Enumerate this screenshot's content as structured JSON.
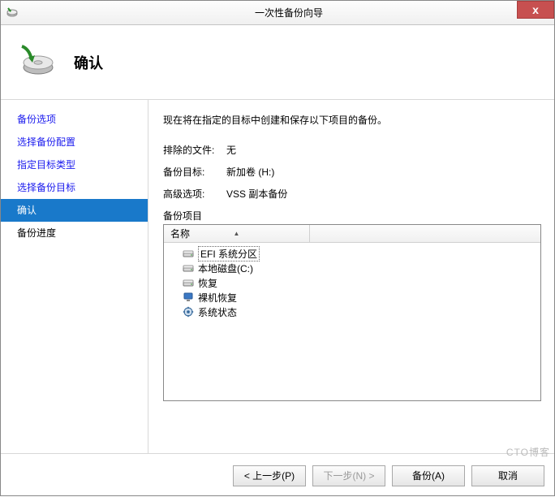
{
  "window": {
    "title": "一次性备份向导",
    "close_glyph": "x"
  },
  "header": {
    "page_title": "确认"
  },
  "sidebar": {
    "items": [
      {
        "label": "备份选项",
        "state": "past"
      },
      {
        "label": "选择备份配置",
        "state": "past"
      },
      {
        "label": "指定目标类型",
        "state": "past"
      },
      {
        "label": "选择备份目标",
        "state": "past"
      },
      {
        "label": "确认",
        "state": "current"
      },
      {
        "label": "备份进度",
        "state": "future"
      }
    ]
  },
  "main": {
    "intro": "现在将在指定的目标中创建和保存以下项目的备份。",
    "excluded_label": "排除的文件:",
    "excluded_value": "无",
    "target_label": "备份目标:",
    "target_value": "新加卷 (H:)",
    "advanced_label": "高级选项:",
    "advanced_value": "VSS 副本备份",
    "items_label": "备份项目",
    "column_name": "名称",
    "rows": [
      {
        "icon": "drive-icon",
        "text": "EFI 系统分区",
        "selected": true
      },
      {
        "icon": "drive-icon",
        "text": "本地磁盘(C:)",
        "selected": false
      },
      {
        "icon": "drive-icon",
        "text": "恢复",
        "selected": false
      },
      {
        "icon": "pc-icon",
        "text": "裸机恢复",
        "selected": false
      },
      {
        "icon": "gear-icon",
        "text": "系统状态",
        "selected": false
      }
    ]
  },
  "footer": {
    "prev": "< 上一步(P)",
    "next": "下一步(N) >",
    "action": "备份(A)",
    "cancel": "取消"
  },
  "watermark": "CTO博客"
}
